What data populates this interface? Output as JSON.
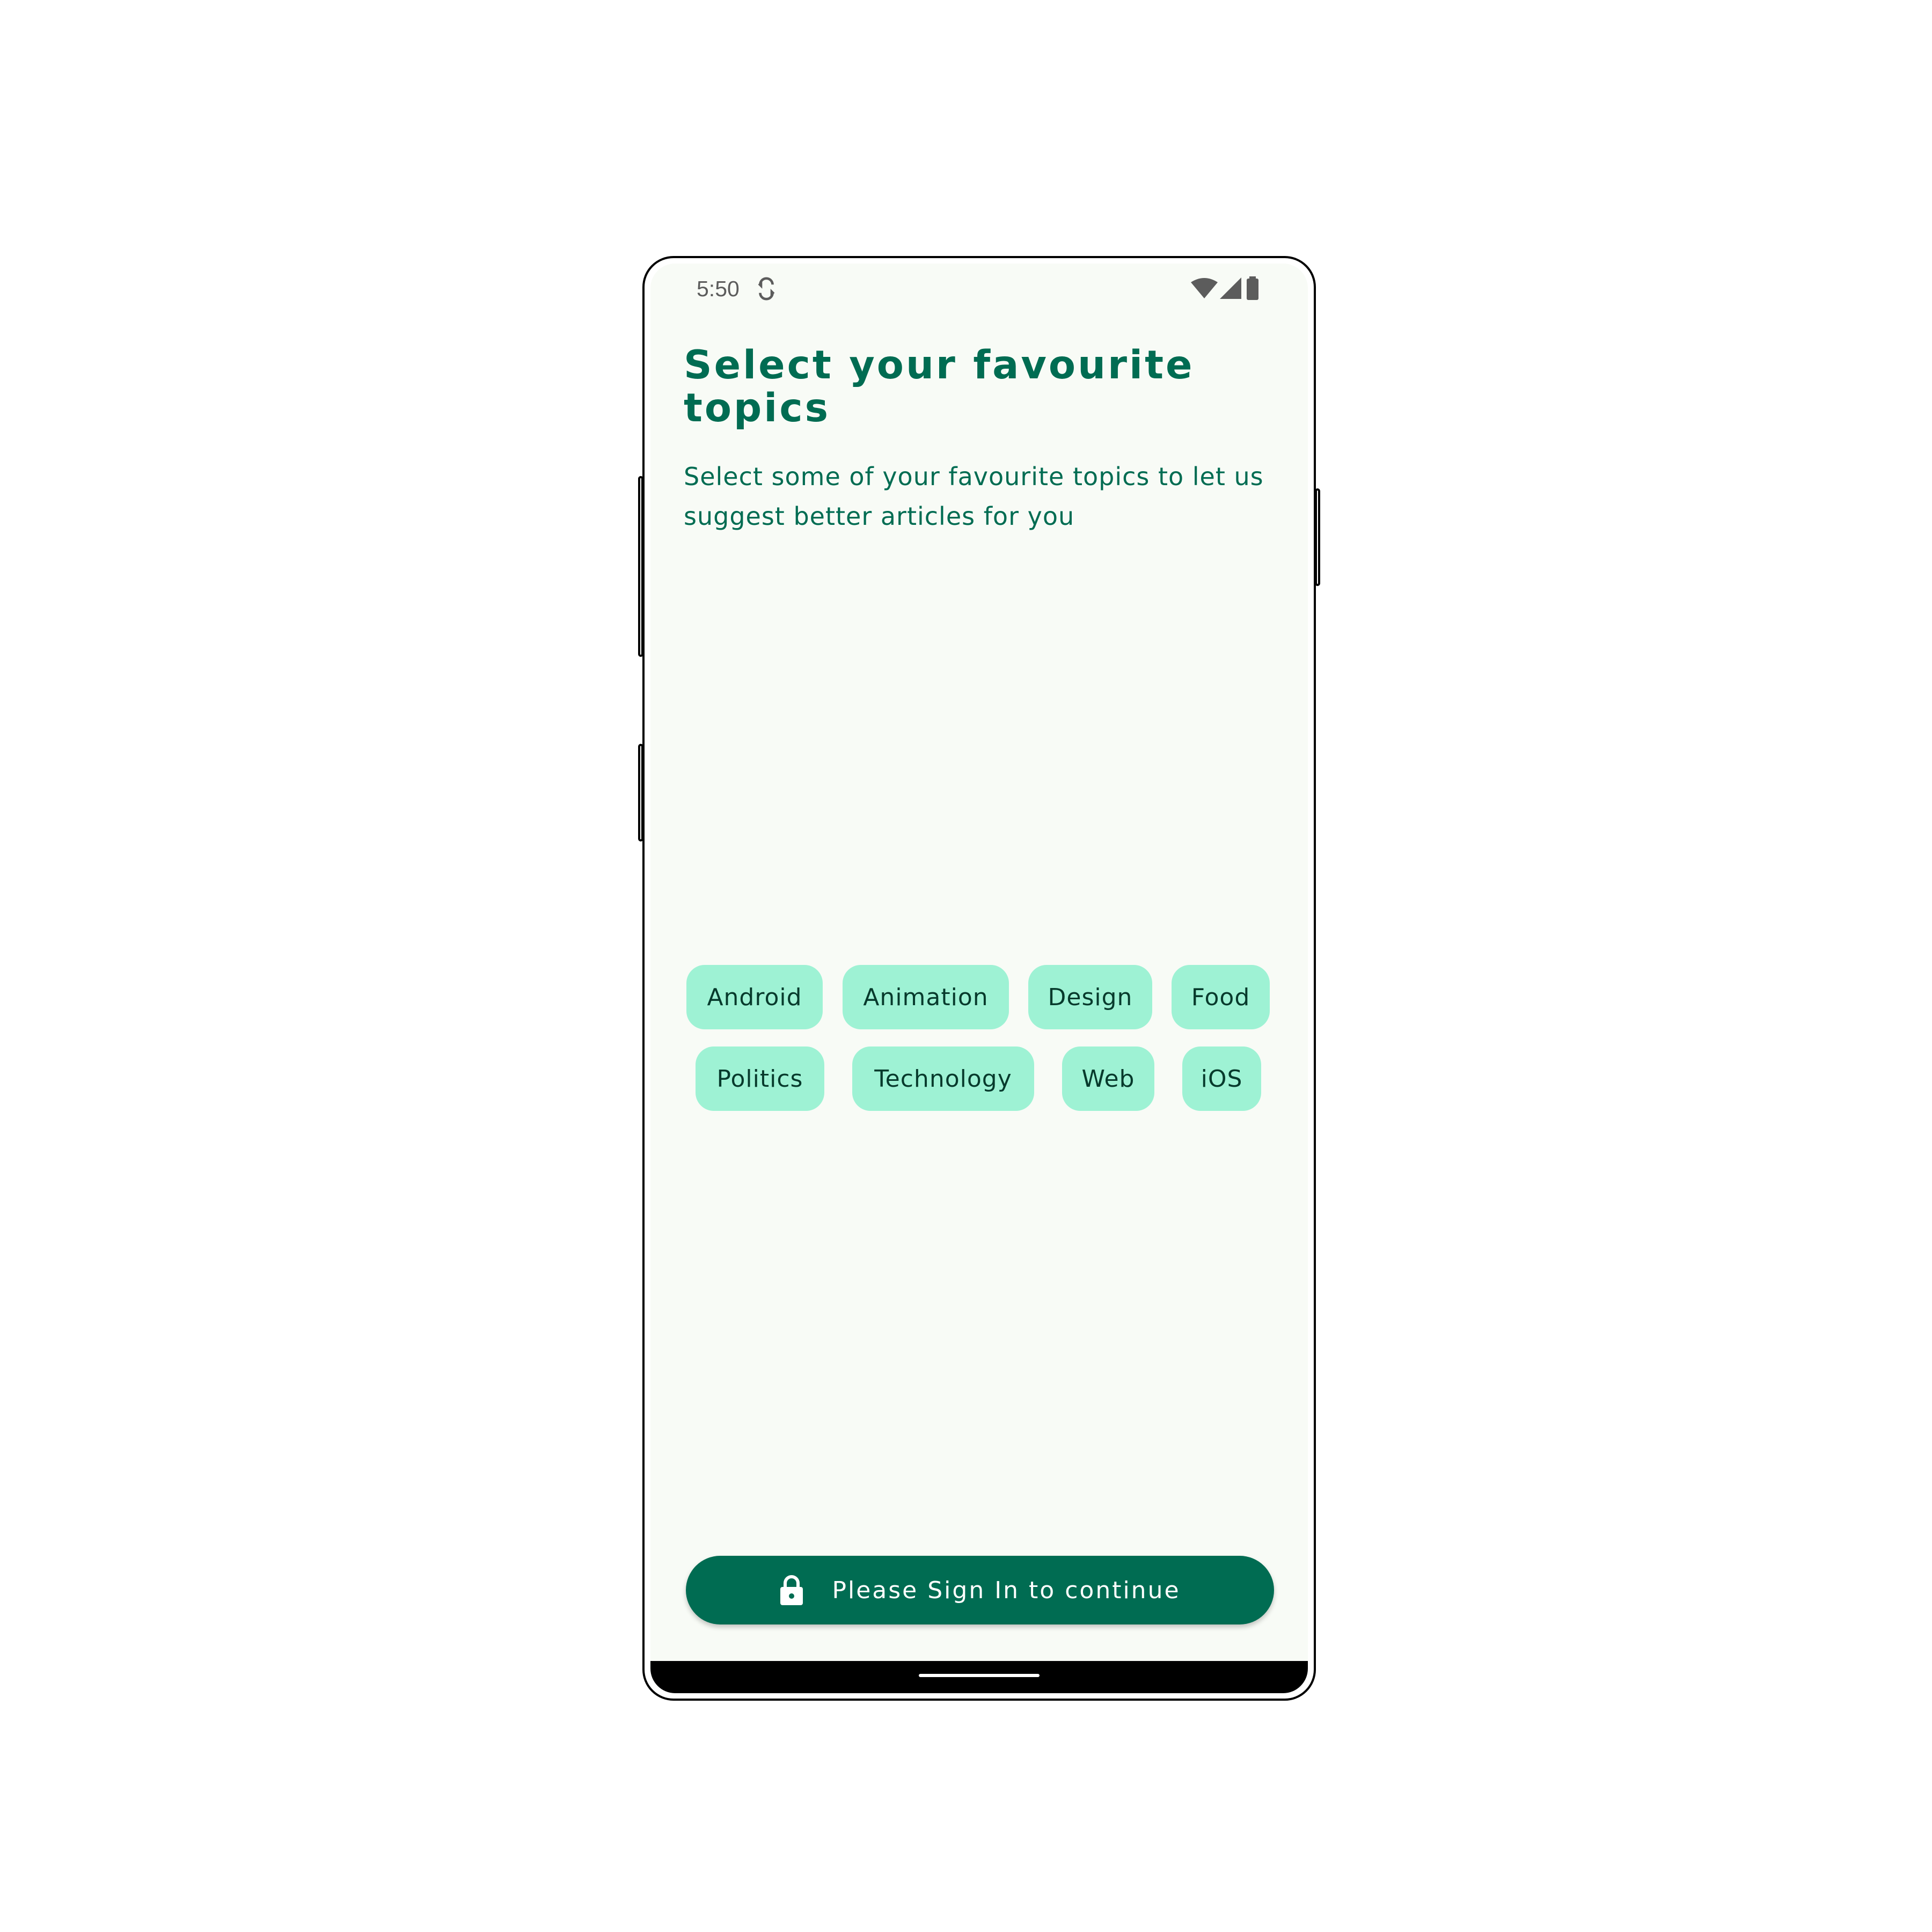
{
  "status_bar": {
    "time": "5:50",
    "icons": [
      "sync-icon",
      "wifi-icon",
      "cellular-signal-icon",
      "battery-icon"
    ]
  },
  "header": {
    "title": "Select your favourite topics",
    "subtitle": "Select some of your favourite topics to let us suggest better articles for you"
  },
  "topics": {
    "row1": [
      "Android",
      "Animation",
      "Design",
      "Food"
    ],
    "row2": [
      "Politics",
      "Technology",
      "Web",
      "iOS"
    ]
  },
  "signin_button": {
    "label": "Please Sign In to continue",
    "icon": "lock-icon"
  },
  "colors": {
    "primary": "#006c52",
    "chip_background": "#9ef2d4",
    "chip_text": "#073a2c",
    "screen_background": "#f8fbf6"
  }
}
